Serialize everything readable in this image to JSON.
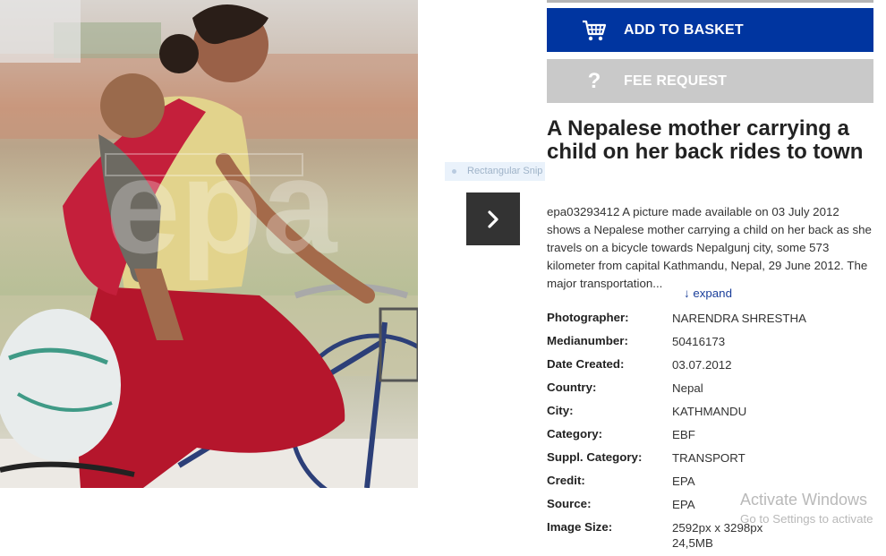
{
  "image": {
    "description_icon": "photo-bicycle-mother-child",
    "watermark": "epa"
  },
  "overlay_hint": "Rectangular Snip",
  "nav": {
    "next_icon": "chevron-right-icon"
  },
  "actions": {
    "basket_label": "ADD TO BASKET",
    "basket_icon": "cart-icon",
    "fee_label": "FEE REQUEST",
    "fee_icon": "question-icon"
  },
  "title": "A Nepalese mother carrying a child on her back rides to town",
  "description": "epa03293412 A picture made available on 03 July 2012 shows a Nepalese mother carrying a child on her back as she travels on a bicycle towards Nepalgunj city, some 573 kilometer from capital Kathmandu, Nepal, 29 June 2012. The major transportation...",
  "expand_label": "↓ expand",
  "meta": [
    {
      "key": "Photographer:",
      "value": "NARENDRA SHRESTHA"
    },
    {
      "key": "Medianumber:",
      "value": "50416173"
    },
    {
      "key": "Date Created:",
      "value": "03.07.2012"
    },
    {
      "key": "Country:",
      "value": "Nepal"
    },
    {
      "key": "City:",
      "value": "KATHMANDU"
    },
    {
      "key": "Category:",
      "value": "EBF"
    },
    {
      "key": "Suppl. Category:",
      "value": "TRANSPORT"
    },
    {
      "key": "Credit:",
      "value": "EPA"
    },
    {
      "key": "Source:",
      "value": "EPA"
    },
    {
      "key": "Image Size:",
      "value": "2592px x 3298px 24,5MB"
    }
  ],
  "os_watermark": {
    "line1": "Activate Windows",
    "line2": "Go to Settings to activate"
  }
}
